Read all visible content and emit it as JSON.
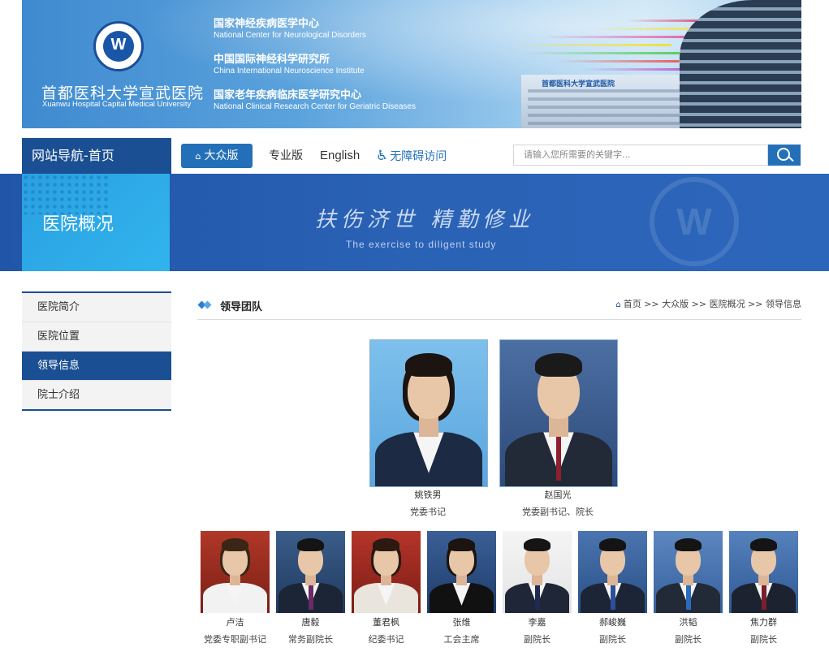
{
  "header": {
    "logo_cn": "首都医科大学宣武医院",
    "logo_en": "Xuanwu Hospital Capital Medical University",
    "centers": [
      {
        "cn": "国家神经疾病医学中心",
        "en": "National Center for Neurological Disorders"
      },
      {
        "cn": "中国国际神经科学研究所",
        "en": "China International Neuroscience Institute"
      },
      {
        "cn": "国家老年疾病临床医学研究中心",
        "en": "National Clinical Research Center for Geriatric Diseases"
      }
    ],
    "building_sign": "首都医科大学宣武医院"
  },
  "nav": {
    "home_label": "网站导航-首页",
    "public_label": "大众版",
    "pro_label": "专业版",
    "english_label": "English",
    "access_label": "无障碍访问",
    "search_placeholder": "请输入您所需要的关键字..."
  },
  "section": {
    "title": "医院概况",
    "motto_cn": "扶伤济世 精勤修业",
    "motto_en": "The exercise to diligent study"
  },
  "sidebar": {
    "items": [
      {
        "label": "医院简介"
      },
      {
        "label": "医院位置"
      },
      {
        "label": "领导信息"
      },
      {
        "label": "院士介绍"
      }
    ]
  },
  "main": {
    "title": "领导团队",
    "breadcrumb": "首页 >> 大众版 >> 医院概况 >> 领导信息"
  },
  "leaders_top": [
    {
      "name": "姚铁男",
      "role": "党委书记"
    },
    {
      "name": "赵国光",
      "role": "党委副书记、院长"
    }
  ],
  "leaders_bottom": [
    {
      "name": "卢洁",
      "role": "党委专职副书记"
    },
    {
      "name": "唐毅",
      "role": "常务副院长"
    },
    {
      "name": "董君枫",
      "role": "纪委书记"
    },
    {
      "name": "张维",
      "role": "工会主席"
    },
    {
      "name": "李嘉",
      "role": "副院长"
    },
    {
      "name": "郝峻巍",
      "role": "副院长"
    },
    {
      "name": "洪韬",
      "role": "副院长"
    },
    {
      "name": "焦力群",
      "role": "副院长"
    }
  ],
  "colors": {
    "brand_blue": "#1a4f93",
    "accent_blue": "#2470b8",
    "banner_blue": "#2a62b5"
  }
}
